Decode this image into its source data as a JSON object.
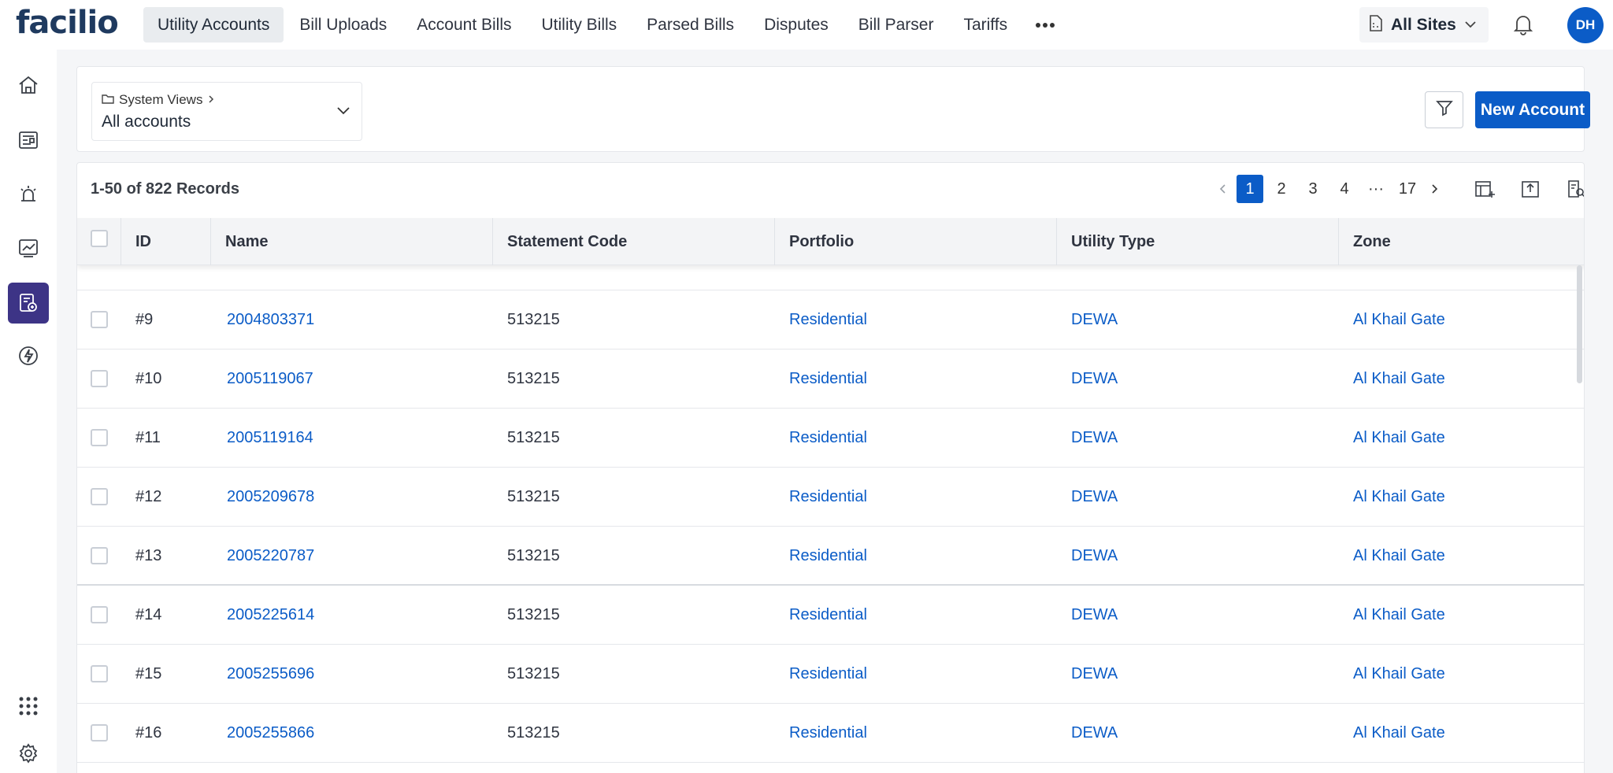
{
  "brand": {
    "logo": "facilio"
  },
  "nav": {
    "items": [
      {
        "label": "Utility Accounts",
        "active": true
      },
      {
        "label": "Bill Uploads"
      },
      {
        "label": "Account Bills"
      },
      {
        "label": "Utility Bills"
      },
      {
        "label": "Parsed Bills"
      },
      {
        "label": "Disputes"
      },
      {
        "label": "Bill Parser"
      },
      {
        "label": "Tariffs"
      }
    ],
    "more_icon": "more-horizontal-icon"
  },
  "site_selector": {
    "label": "All Sites"
  },
  "user": {
    "initials": "DH"
  },
  "rail": {
    "items": [
      "home-icon",
      "dashboard-icon",
      "alarm-icon",
      "analytics-icon",
      "utility-billing-icon",
      "energy-icon"
    ],
    "bottom": [
      "apps-grid-icon",
      "settings-icon"
    ]
  },
  "view": {
    "breadcrumb": "System Views",
    "name": "All accounts"
  },
  "actions": {
    "new_account": "New Account"
  },
  "list": {
    "records_label": "1-50 of 822 Records",
    "pages": [
      "1",
      "2",
      "3",
      "4",
      "···",
      "17"
    ],
    "active_page": "1"
  },
  "table": {
    "columns": [
      "ID",
      "Name",
      "Statement Code",
      "Portfolio",
      "Utility Type",
      "Zone"
    ],
    "rows": [
      {
        "id": "#9",
        "name": "2004803371",
        "code": "513215",
        "portfolio": "Residential",
        "type": "DEWA",
        "zone": "Al Khail Gate"
      },
      {
        "id": "#10",
        "name": "2005119067",
        "code": "513215",
        "portfolio": "Residential",
        "type": "DEWA",
        "zone": "Al Khail Gate"
      },
      {
        "id": "#11",
        "name": "2005119164",
        "code": "513215",
        "portfolio": "Residential",
        "type": "DEWA",
        "zone": "Al Khail Gate"
      },
      {
        "id": "#12",
        "name": "2005209678",
        "code": "513215",
        "portfolio": "Residential",
        "type": "DEWA",
        "zone": "Al Khail Gate"
      },
      {
        "id": "#13",
        "name": "2005220787",
        "code": "513215",
        "portfolio": "Residential",
        "type": "DEWA",
        "zone": "Al Khail Gate"
      },
      {
        "id": "#14",
        "name": "2005225614",
        "code": "513215",
        "portfolio": "Residential",
        "type": "DEWA",
        "zone": "Al Khail Gate"
      },
      {
        "id": "#15",
        "name": "2005255696",
        "code": "513215",
        "portfolio": "Residential",
        "type": "DEWA",
        "zone": "Al Khail Gate"
      },
      {
        "id": "#16",
        "name": "2005255866",
        "code": "513215",
        "portfolio": "Residential",
        "type": "DEWA",
        "zone": "Al Khail Gate"
      }
    ]
  },
  "colors": {
    "primary": "#0b5cc7",
    "rail_active": "#3d3486"
  }
}
